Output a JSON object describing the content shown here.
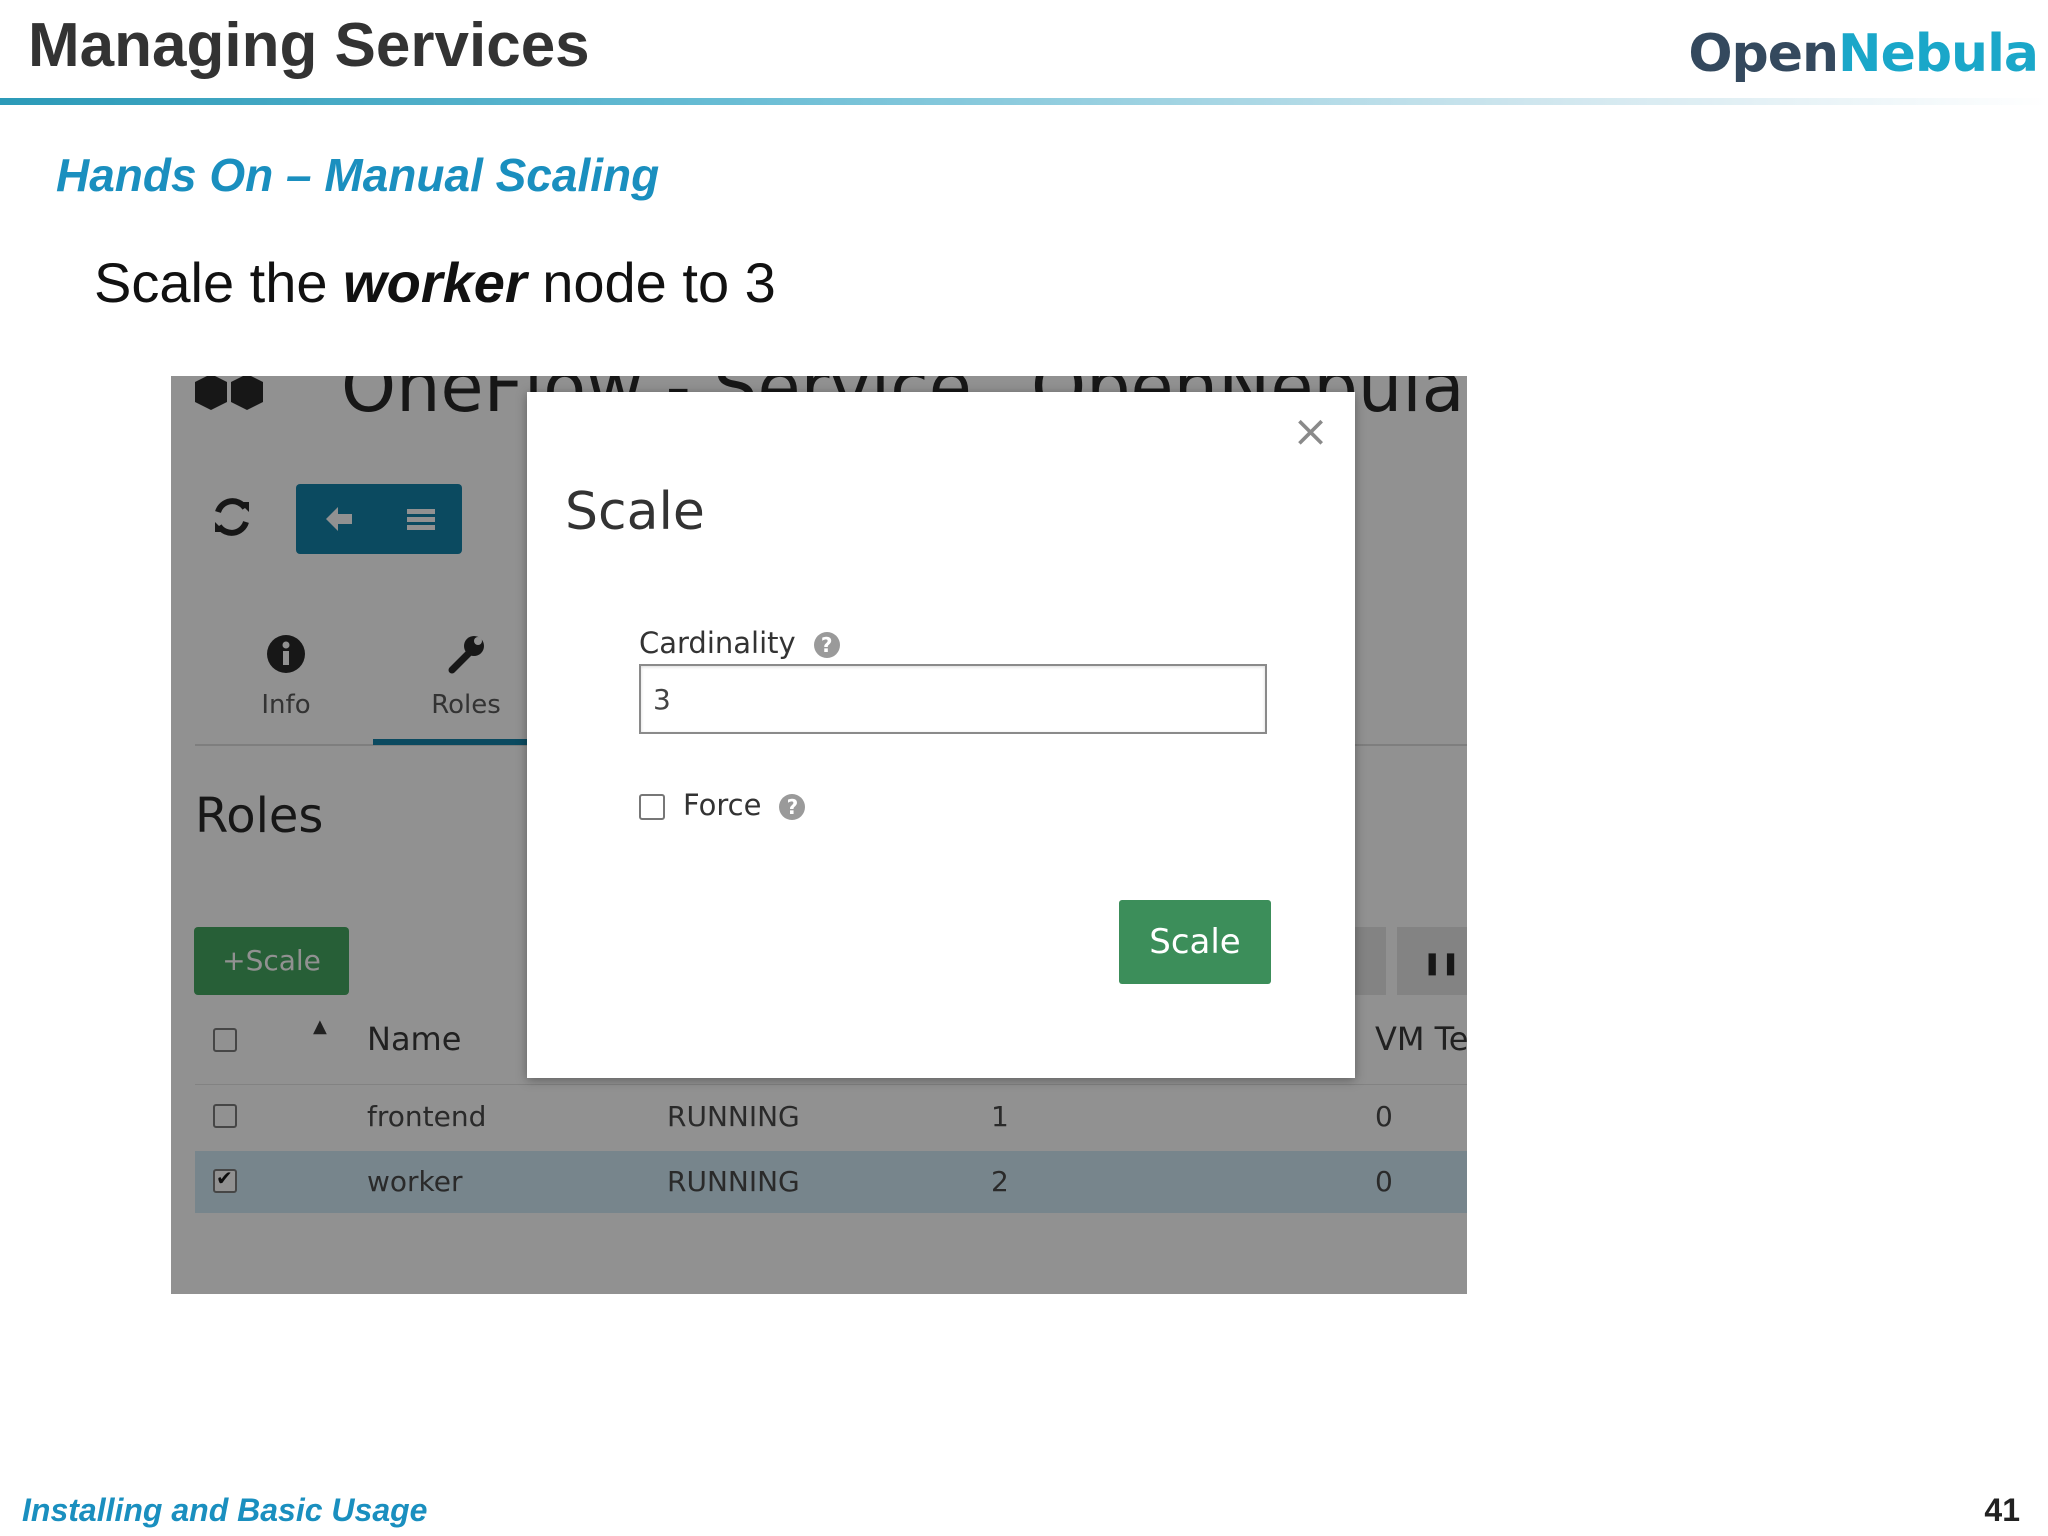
{
  "slide": {
    "title": "Managing Services",
    "logo_part1": "Open",
    "logo_part2": "Nebula",
    "subtitle": "Hands On – Manual Scaling",
    "instruction_pre": "Scale the ",
    "instruction_bold": "worker",
    "instruction_post": " node to 3",
    "footer": "Installing and Basic Usage",
    "page_number": "41"
  },
  "background_ui": {
    "title_left": "OneFlow - Service",
    "title_right": "OpenNebula W",
    "tabs": [
      {
        "label": "Info",
        "icon": "info-icon"
      },
      {
        "label": "Roles",
        "icon": "wrench-icon"
      }
    ],
    "roles_heading": "Roles",
    "scale_button": "Scale",
    "table": {
      "columns": [
        "Name",
        "VM Te"
      ],
      "rows": [
        {
          "name": "frontend",
          "state": "RUNNING",
          "cardinality": "1",
          "vm_template": "0",
          "selected": false
        },
        {
          "name": "worker",
          "state": "RUNNING",
          "cardinality": "2",
          "vm_template": "0",
          "selected": true
        }
      ]
    }
  },
  "modal": {
    "title": "Scale",
    "close": "×",
    "cardinality_label": "Cardinality",
    "cardinality_value": "3",
    "force_label": "Force",
    "scale_button": "Scale"
  },
  "colors": {
    "accent": "#1a8fbf",
    "primary_button": "#0c7fa6",
    "success_button": "#3c8e5a"
  }
}
